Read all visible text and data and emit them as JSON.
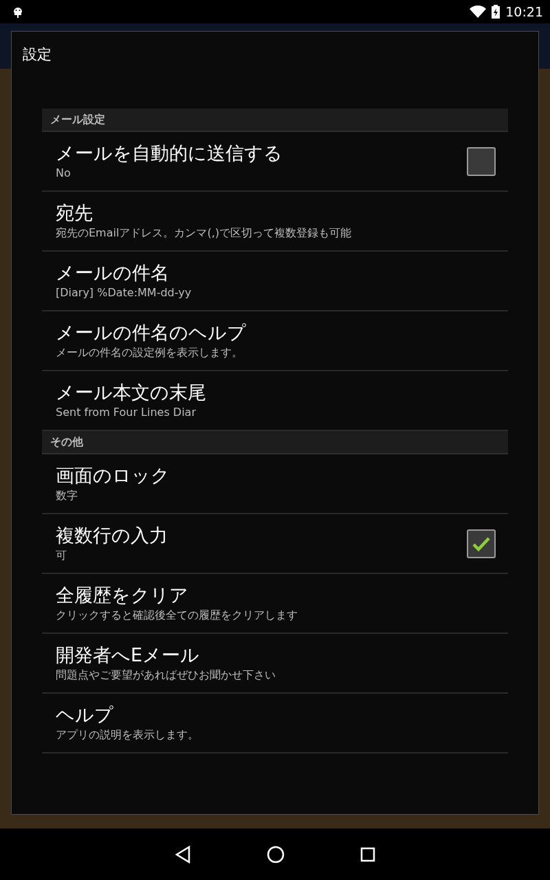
{
  "status_bar": {
    "time": "10:21"
  },
  "dialog": {
    "title": "設定",
    "sections": [
      {
        "header": "メール設定",
        "items": [
          {
            "kind": "checkbox",
            "title": "メールを自動的に送信する",
            "summary": "No",
            "checked": false
          },
          {
            "kind": "plain",
            "title": "宛先",
            "summary": "宛先のEmailアドレス。カンマ(,)で区切って複数登録も可能"
          },
          {
            "kind": "plain",
            "title": "メールの件名",
            "summary": "[Diary] %Date:MM-dd-yy"
          },
          {
            "kind": "plain",
            "title": "メールの件名のヘルプ",
            "summary": "メールの件名の設定例を表示します。"
          },
          {
            "kind": "plain",
            "title": "メール本文の末尾",
            "summary": "Sent from Four Lines Diar"
          }
        ]
      },
      {
        "header": "その他",
        "items": [
          {
            "kind": "plain",
            "title": "画面のロック",
            "summary": "数字"
          },
          {
            "kind": "checkbox",
            "title": "複数行の入力",
            "summary": "可",
            "checked": true
          },
          {
            "kind": "plain",
            "title": "全履歴をクリア",
            "summary": "クリックすると確認後全ての履歴をクリアします"
          },
          {
            "kind": "plain",
            "title": "開発者へEメール",
            "summary": "問題点やご要望があればぜひお聞かせ下さい"
          },
          {
            "kind": "plain",
            "title": "ヘルプ",
            "summary": "アプリの説明を表示します。"
          }
        ]
      }
    ]
  }
}
